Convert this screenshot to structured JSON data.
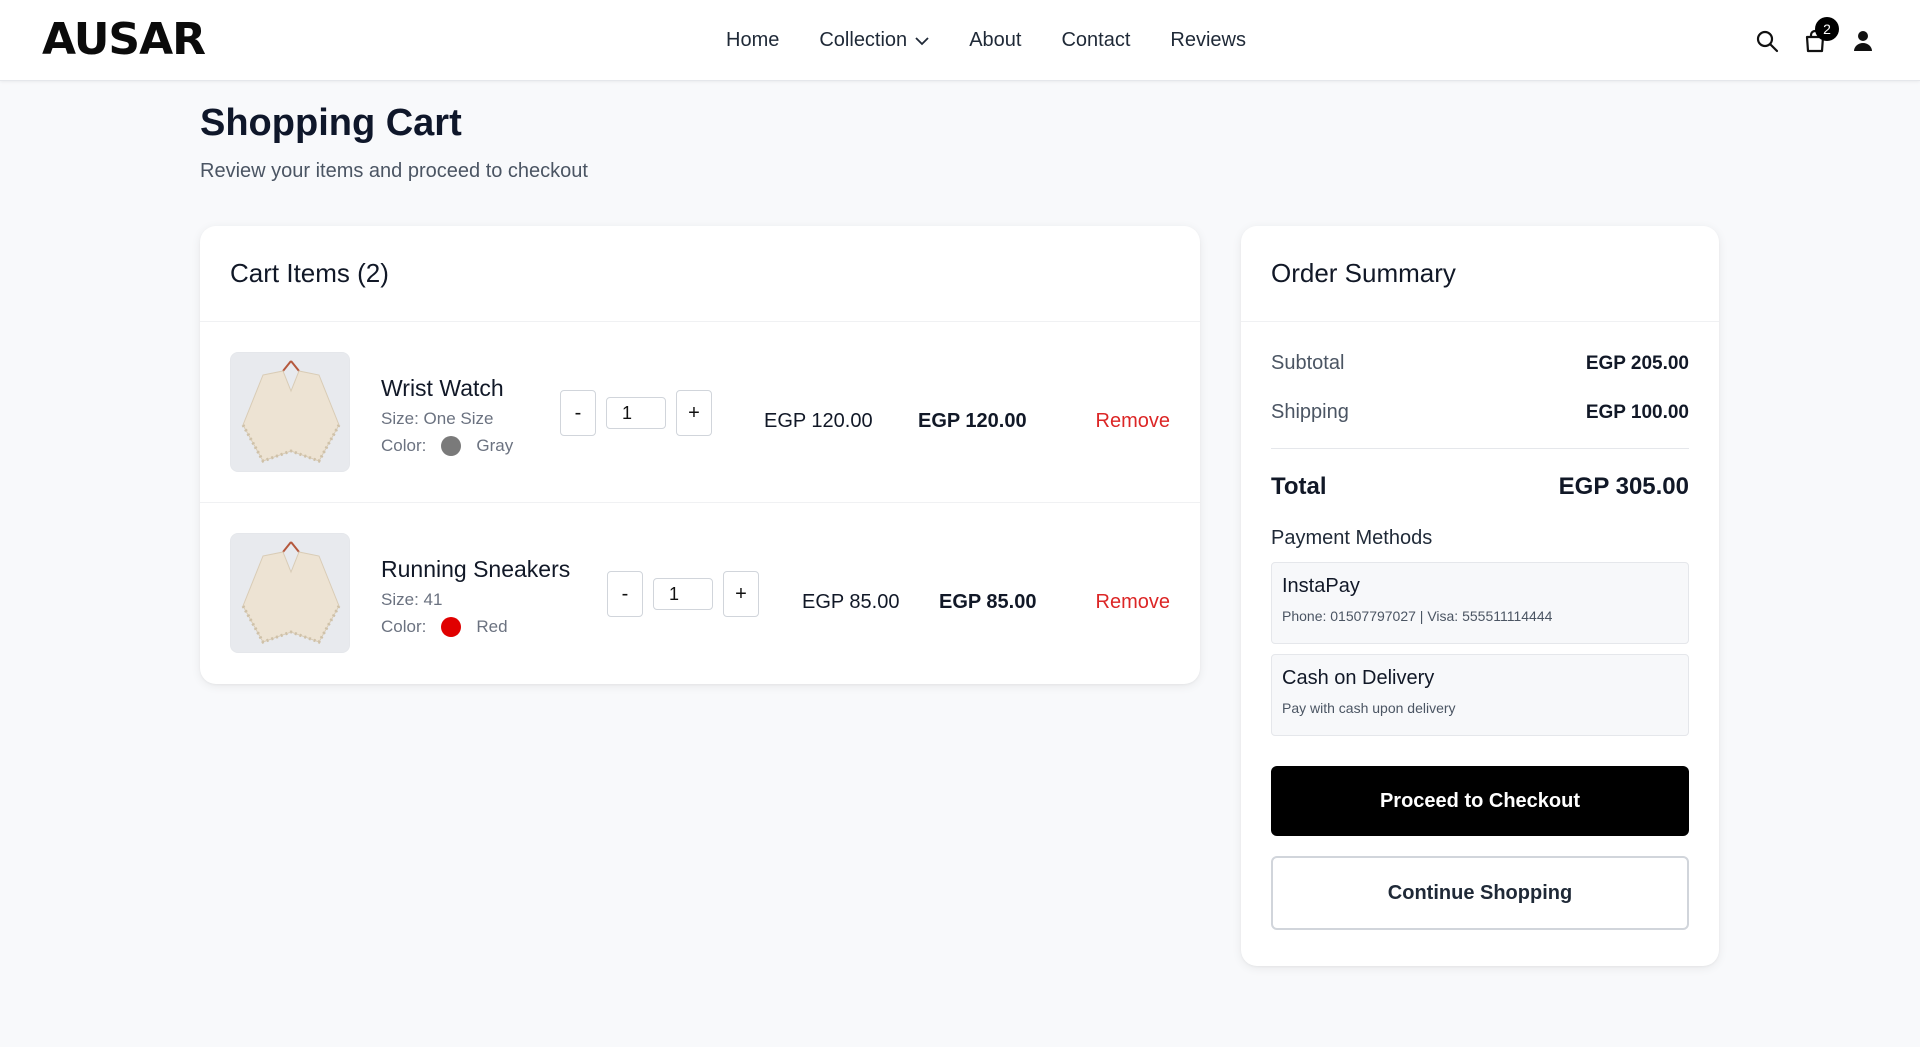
{
  "nav": {
    "logo": "AUSAR",
    "links": [
      "Home",
      "Collection",
      "About",
      "Contact",
      "Reviews"
    ],
    "cart_count": "2"
  },
  "page": {
    "title": "Shopping Cart",
    "subtitle": "Review your items and proceed to checkout"
  },
  "cart": {
    "heading": "Cart Items (2)",
    "items": [
      {
        "name": "Wrist Watch",
        "size": "Size: One Size",
        "color_label": "Color:",
        "color_name": "Gray",
        "color_hex": "#7a7a7a",
        "qty": "1",
        "unit_price": "EGP 120.00",
        "line_total": "EGP 120.00",
        "remove": "Remove"
      },
      {
        "name": "Running Sneakers",
        "size": "Size: 41",
        "color_label": "Color:",
        "color_name": "Red",
        "color_hex": "#e00000",
        "qty": "1",
        "unit_price": "EGP 85.00",
        "line_total": "EGP 85.00",
        "remove": "Remove"
      }
    ],
    "qty_minus": "-",
    "qty_plus": "+"
  },
  "summary": {
    "heading": "Order Summary",
    "subtotal_label": "Subtotal",
    "subtotal_value": "EGP 205.00",
    "shipping_label": "Shipping",
    "shipping_value": "EGP 100.00",
    "total_label": "Total",
    "total_value": "EGP 305.00",
    "payment_title": "Payment Methods",
    "payment_methods": [
      {
        "name": "InstaPay",
        "desc": "Phone: 01507797027 | Visa: 555511114444"
      },
      {
        "name": "Cash on Delivery",
        "desc": "Pay with cash upon delivery"
      }
    ],
    "checkout_label": "Proceed to Checkout",
    "continue_label": "Continue Shopping"
  },
  "colors": {
    "accent": "#000000",
    "remove": "#dc2626",
    "background": "#f8f9fb"
  }
}
